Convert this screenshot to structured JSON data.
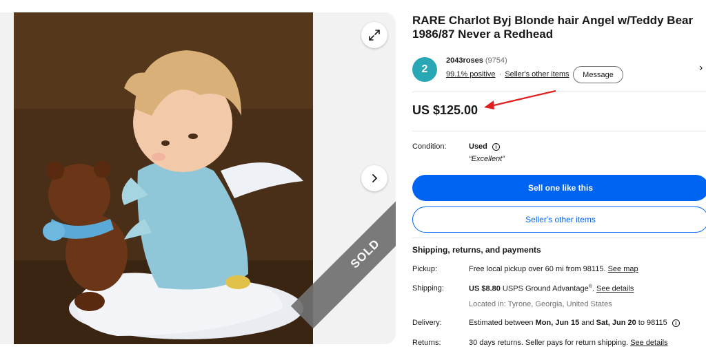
{
  "listing": {
    "title": "RARE Charlot Byj Blonde hair Angel w/Teddy Bear 1986/87 Never a Redhead",
    "price": "US $125.00",
    "sold_badge": "SOLD"
  },
  "gallery": {
    "expand_icon": "expand-arrows-icon",
    "next_icon": "chevron-right-icon"
  },
  "seller": {
    "avatar_letter": "2",
    "name": "2043roses",
    "feedback_count": "(9754)",
    "positive": "99.1% positive",
    "other_items_link": "Seller's other items",
    "separator": "·",
    "message_button": "Message"
  },
  "condition": {
    "label": "Condition:",
    "value": "Used",
    "note": "“Excellent”"
  },
  "actions": {
    "sell_one": "Sell one like this",
    "seller_other_items": "Seller's other items"
  },
  "shipping": {
    "section_title": "Shipping, returns, and payments",
    "pickup_label": "Pickup:",
    "pickup_text": "Free local pickup over 60 mi from 98115. ",
    "pickup_link": "See map",
    "shipping_label": "Shipping:",
    "shipping_price": "US $8.80",
    "shipping_method": " USPS Ground Advantage",
    "shipping_reg": "®",
    "shipping_sep": ". ",
    "shipping_link": "See details",
    "located_in": "Located in: Tyrone, Georgia, United States",
    "delivery_label": "Delivery:",
    "delivery_prefix": "Estimated between ",
    "delivery_start": "Mon, Jun 15",
    "delivery_and": " and ",
    "delivery_end": "Sat, Jun 20",
    "delivery_suffix": " to 98115",
    "returns_label": "Returns:",
    "returns_text": "30 days returns. Seller pays for return shipping. ",
    "returns_link": "See details"
  },
  "colors": {
    "primary_blue": "#0064f2",
    "avatar_teal": "#2aa7b5",
    "annotation_red": "#e02020"
  }
}
